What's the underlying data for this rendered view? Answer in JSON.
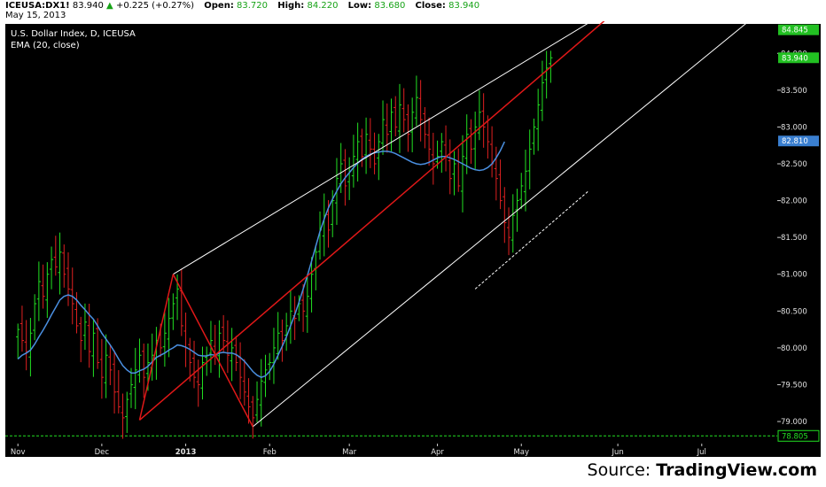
{
  "header": {
    "symbol": "ICEUSA:DX1!",
    "last": "83.940",
    "change_arrow": "▲",
    "change": "+0.225 (+0.27%)",
    "open_label": "Open:",
    "open": "83.720",
    "high_label": "High:",
    "high": "84.220",
    "low_label": "Low:",
    "low": "83.680",
    "close_label": "Close:",
    "close": "83.940",
    "date": "May 15, 2013"
  },
  "legend": {
    "title": "U.S. Dollar Index, D, ICEUSA",
    "indicator": "EMA (20, close)"
  },
  "footer": {
    "source_prefix": "Source: ",
    "source_brand": "TradingView.com"
  },
  "colors": {
    "background": "#000000",
    "up_bar": "#22e022",
    "down_bar": "#e02020",
    "ema": "#4a8fe0",
    "channel": "#ffffff",
    "trendline": "#e01818",
    "support": "#22e022",
    "price_tag": "#22c022",
    "ema_tag": "#3a7fd0"
  },
  "chart_data": {
    "type": "ohlc",
    "title": "U.S. Dollar Index, D, ICEUSA",
    "ylim": [
      78.7,
      84.4
    ],
    "y_ticks": [
      "79.000",
      "79.500",
      "80.000",
      "80.500",
      "81.000",
      "81.500",
      "82.000",
      "82.500",
      "83.000",
      "83.500",
      "84.000"
    ],
    "x_ticks": [
      {
        "label": "Nov",
        "x": 0
      },
      {
        "label": "Dec",
        "x": 20
      },
      {
        "label": "2013",
        "x": 40
      },
      {
        "label": "Feb",
        "x": 60
      },
      {
        "label": "Mar",
        "x": 79
      },
      {
        "label": "Apr",
        "x": 100
      },
      {
        "label": "May",
        "x": 120
      },
      {
        "label": "Jun",
        "x": 143
      },
      {
        "label": "Jul",
        "x": 163
      }
    ],
    "x_range": [
      -3,
      181
    ],
    "axis_tags": [
      {
        "label": "83.940",
        "value": 83.94,
        "kind": "price"
      },
      {
        "label": "84.845",
        "value": 84.32,
        "kind": "trendline"
      },
      {
        "label": "82.810",
        "value": 82.81,
        "kind": "ema"
      },
      {
        "label": "78.805",
        "value": 78.805,
        "kind": "support"
      }
    ],
    "support_level": 78.805,
    "closes": [
      80.25,
      80.1,
      79.95,
      80.2,
      80.6,
      80.9,
      80.7,
      81.0,
      81.2,
      81.1,
      81.3,
      81.0,
      80.8,
      80.6,
      80.3,
      80.1,
      80.35,
      79.95,
      80.2,
      79.8,
      79.6,
      79.9,
      79.7,
      79.4,
      79.2,
      79.05,
      79.3,
      79.5,
      79.7,
      79.9,
      79.6,
      79.8,
      79.9,
      80.1,
      80.0,
      80.2,
      80.4,
      80.6,
      80.8,
      80.3,
      80.0,
      79.8,
      79.6,
      79.5,
      79.8,
      79.9,
      80.1,
      79.9,
      80.2,
      80.1,
      79.9,
      80.0,
      79.8,
      79.6,
      79.4,
      79.2,
      79.05,
      79.3,
      79.55,
      79.7,
      79.8,
      80.0,
      80.2,
      80.1,
      80.3,
      80.5,
      80.4,
      80.6,
      80.5,
      80.7,
      81.0,
      81.3,
      81.6,
      81.8,
      81.6,
      82.0,
      82.3,
      82.5,
      82.2,
      82.4,
      82.6,
      82.8,
      82.6,
      82.9,
      82.7,
      82.5,
      82.8,
      83.1,
      82.9,
      83.2,
      83.0,
      83.3,
      83.1,
      82.9,
      83.2,
      83.4,
      83.1,
      82.9,
      82.7,
      82.5,
      82.6,
      82.8,
      82.6,
      82.3,
      82.5,
      82.2,
      82.6,
      82.9,
      82.7,
      83.0,
      83.2,
      83.0,
      82.8,
      82.5,
      82.3,
      82.0,
      81.7,
      81.5,
      81.8,
      82.0,
      82.2,
      82.4,
      82.7,
      83.0,
      83.3,
      83.6,
      83.8,
      83.94
    ],
    "ema20": [
      79.85,
      79.9,
      79.93,
      79.97,
      80.05,
      80.15,
      80.24,
      80.34,
      80.45,
      80.55,
      80.65,
      80.7,
      80.72,
      80.7,
      80.65,
      80.58,
      80.52,
      80.45,
      80.39,
      80.3,
      80.2,
      80.12,
      80.04,
      79.95,
      79.85,
      79.76,
      79.7,
      79.66,
      79.66,
      79.69,
      79.71,
      79.75,
      79.81,
      79.87,
      79.9,
      79.93,
      79.97,
      80.0,
      80.04,
      80.03,
      80.01,
      79.98,
      79.94,
      79.9,
      79.89,
      79.89,
      79.91,
      79.9,
      79.93,
      79.94,
      79.93,
      79.93,
      79.91,
      79.87,
      79.82,
      79.75,
      79.68,
      79.63,
      79.6,
      79.62,
      79.68,
      79.78,
      79.9,
      80.02,
      80.15,
      80.3,
      80.45,
      80.62,
      80.8,
      80.98,
      81.18,
      81.38,
      81.58,
      81.75,
      81.9,
      82.02,
      82.13,
      82.23,
      82.31,
      82.38,
      82.45,
      82.51,
      82.56,
      82.6,
      82.63,
      82.65,
      82.66,
      82.67,
      82.67,
      82.66,
      82.64,
      82.61,
      82.58,
      82.55,
      82.52,
      82.5,
      82.49,
      82.5,
      82.52,
      82.55,
      82.58,
      82.6,
      82.6,
      82.58,
      82.56,
      82.53,
      82.5,
      82.47,
      82.44,
      82.42,
      82.41,
      82.42,
      82.45,
      82.5,
      82.58,
      82.68,
      82.8
    ],
    "channel_lines": [
      {
        "from": [
          37,
          81.0
        ],
        "to": [
          140,
          84.55
        ],
        "style": "solid",
        "color": "channel"
      },
      {
        "from": [
          56,
          78.93
        ],
        "to": [
          176,
          84.52
        ],
        "style": "solid",
        "color": "channel"
      },
      {
        "from": [
          109,
          80.8
        ],
        "to": [
          136,
          82.13
        ],
        "style": "dashed",
        "color": "channel"
      }
    ],
    "trend_lines": [
      {
        "from": [
          29,
          79.02
        ],
        "to": [
          37,
          81.0
        ]
      },
      {
        "from": [
          37,
          81.0
        ],
        "to": [
          56,
          78.93
        ]
      },
      {
        "from": [
          29,
          79.02
        ],
        "to": [
          142,
          84.55
        ]
      }
    ]
  }
}
